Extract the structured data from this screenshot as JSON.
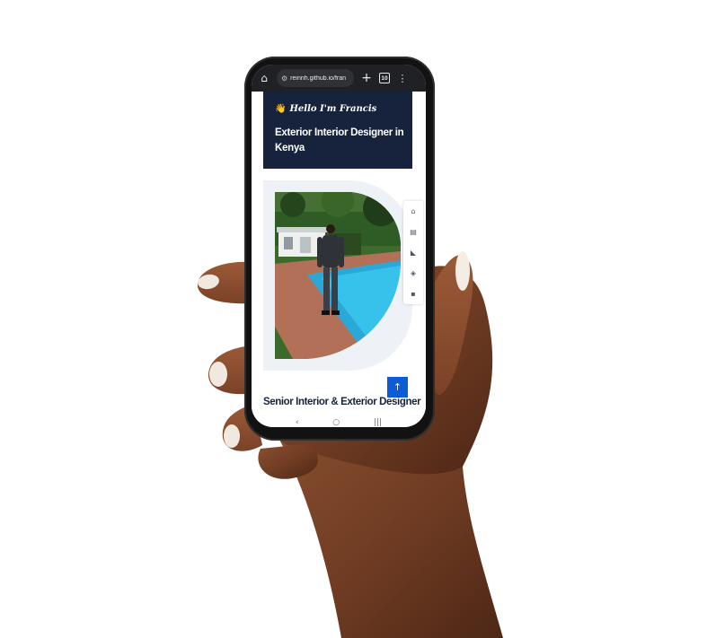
{
  "browser": {
    "url": "reinnh.github.io/fran",
    "tab_count": "10",
    "icons": [
      "home-icon",
      "site-settings-icon",
      "new-tab-icon",
      "tab-switcher-icon",
      "more-menu-icon"
    ]
  },
  "hero": {
    "greeting": "Hello I'm Francis",
    "greeting_icon": "👋",
    "headline": "Exterior Interior Designer in Kenya",
    "card_color": "#17233d"
  },
  "side_nav": {
    "items": [
      {
        "icon": "home-icon",
        "glyph": "⌂"
      },
      {
        "icon": "id-card-icon",
        "glyph": "▤"
      },
      {
        "icon": "skills-icon",
        "glyph": "◣"
      },
      {
        "icon": "portfolio-icon",
        "glyph": "◈"
      },
      {
        "icon": "contact-icon",
        "glyph": "▪"
      }
    ]
  },
  "scroll_top": {
    "icon": "arrow-up-icon",
    "glyph": "↑",
    "color": "#0d5bd6"
  },
  "subtitle": "Senior Interior & Exterior Designer",
  "android_nav": {
    "back": "‹",
    "home": "○",
    "recents": "|||"
  }
}
